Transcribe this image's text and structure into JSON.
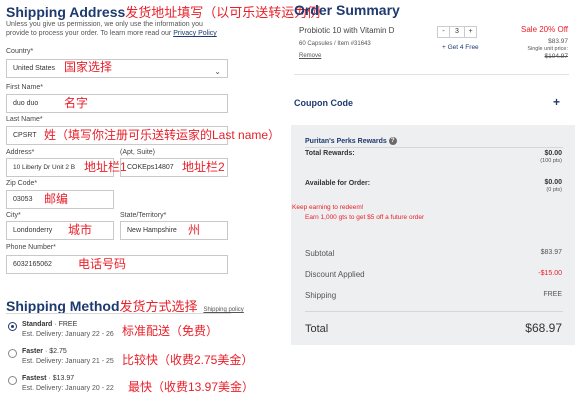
{
  "shipping_address": {
    "title": "Shipping Address",
    "title_annotation": "发货地址填写（以可乐送转运为例",
    "intro_line1": "Unless you give us permission, we only use the information you",
    "intro_line2_prefix": "provide to process your order. To learn more read our ",
    "privacy_link": "Privacy Policy",
    "country": {
      "label": "Country*",
      "value": "United States",
      "annotation": "国家选择"
    },
    "first_name": {
      "label": "First Name*",
      "value": "duo duo",
      "annotation": "名字"
    },
    "last_name": {
      "label": "Last Name*",
      "value": "CPSRT",
      "annotation": "姓（填写你注册可乐送转运家的Last name）"
    },
    "address": {
      "label": "Address*",
      "value": "10 Liberty Dr Unit 2 B",
      "annotation": "地址栏1"
    },
    "apt": {
      "label": "(Apt, Suite)",
      "value": "COKEps14807",
      "annotation": "地址栏2"
    },
    "zip": {
      "label": "Zip Code*",
      "value": "03053",
      "annotation": "邮编"
    },
    "city": {
      "label": "City*",
      "value": "Londonderry",
      "annotation": "城市"
    },
    "state": {
      "label": "State/Territory*",
      "value": "New Hampshire",
      "annotation": "州"
    },
    "phone": {
      "label": "Phone Number*",
      "value": "6032165062",
      "annotation": "电话号码"
    }
  },
  "shipping_method": {
    "title": "Shipping Method",
    "title_annotation": "发货方式选择",
    "policy_link": "Shipping policy",
    "options": [
      {
        "name": "Standard",
        "price": "FREE",
        "delivery": "Est. Delivery: January 22 - 26",
        "annotation": "标准配送（免费）",
        "selected": true
      },
      {
        "name": "Faster",
        "price": "$2.75",
        "delivery": "Est. Delivery: January 21 - 25",
        "annotation": "比较快（收费2.75美金）",
        "selected": false
      },
      {
        "name": "Fastest",
        "price": "$13.97",
        "delivery": "Est. Delivery: January 20 - 22",
        "annotation": "最快（收费13.97美金）",
        "selected": false
      }
    ]
  },
  "order_summary": {
    "title": "Order Summary",
    "product": {
      "name": "Probiotic 10 with Vitamin D",
      "details": "60 Capsules / Item #31643",
      "remove": "Remove",
      "qty": "3",
      "minus": "-",
      "plus": "+",
      "promo": "+ Get 4 Free",
      "sale_text": "Sale 20% Off",
      "price": "$83.97",
      "unit_label": "Single unit price:",
      "original_price": "$104.97"
    },
    "coupon": {
      "label": "Coupon Code",
      "toggle": "+"
    },
    "perks": {
      "title": "Puritan's Perks Rewards",
      "info": "?",
      "total_rewards_label": "Total Rewards:",
      "total_rewards_value": "$0.00",
      "total_rewards_pts": "(100 pts)",
      "available_label": "Available for Order:",
      "available_value": "$0.00",
      "available_pts": "(0 pts)",
      "keep_earning": "Keep earning to redeem!",
      "earn_more": "Earn 1,000 gts to get $5 off a future order"
    },
    "totals": {
      "subtotal_label": "Subtotal",
      "subtotal_value": "$83.97",
      "discount_label": "Discount Applied",
      "discount_value": "-$15.00",
      "shipping_label": "Shipping",
      "shipping_value": "FREE",
      "total_label": "Total",
      "total_value": "$68.97"
    }
  },
  "colors": {
    "brand": "#1e3a6e",
    "annotation": "#e8202a",
    "panel_bg": "#eeeff1"
  },
  "icons": [
    "chevron-down-icon",
    "info-icon",
    "plus-icon"
  ]
}
